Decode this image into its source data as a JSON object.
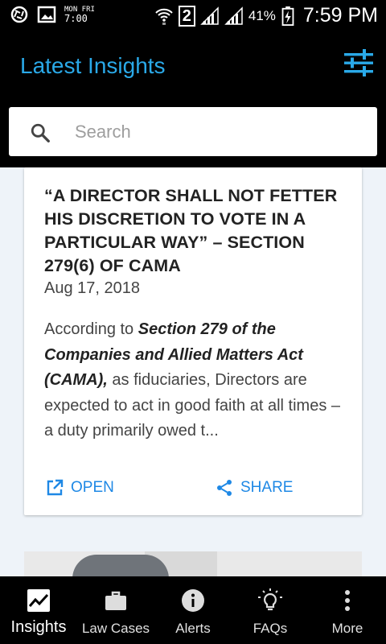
{
  "status_bar": {
    "sim_label": "2",
    "battery": "41%",
    "time": "7:59 PM",
    "mini_clock": "7:00",
    "mini_top": "MON  FRI"
  },
  "app_bar": {
    "title": "Latest Insights",
    "filter_icon": "tune-icon"
  },
  "search": {
    "placeholder": "Search",
    "value": ""
  },
  "insight_card": {
    "title": "“A DIRECTOR SHALL NOT FETTER HIS DISCRETION TO VOTE IN A PARTICULAR WAY” – SECTION 279(6) OF CAMA",
    "date": "Aug 17, 2018",
    "excerpt_intro": "According to ",
    "excerpt_bold": "Section 279 of the Companies and Allied Matters Act (CAMA),",
    "excerpt_rest": " as fiduciaries, Directors are expected to act in good faith at all times – a duty primarily owed t...",
    "open_label": "OPEN",
    "share_label": "SHARE"
  },
  "bottom_nav": {
    "items": [
      {
        "label": "Insights",
        "icon": "chart-icon",
        "active": true
      },
      {
        "label": "Law Cases",
        "icon": "briefcase-icon",
        "active": false
      },
      {
        "label": "Alerts",
        "icon": "info-icon",
        "active": false
      },
      {
        "label": "FAQs",
        "icon": "lightbulb-icon",
        "active": false
      },
      {
        "label": "More",
        "icon": "more-vert-icon",
        "active": false
      }
    ]
  },
  "colors": {
    "accent": "#2aa9e8",
    "action": "#1e88e5",
    "app_bar_bg": "#000000",
    "content_bg": "#eef3f9"
  }
}
